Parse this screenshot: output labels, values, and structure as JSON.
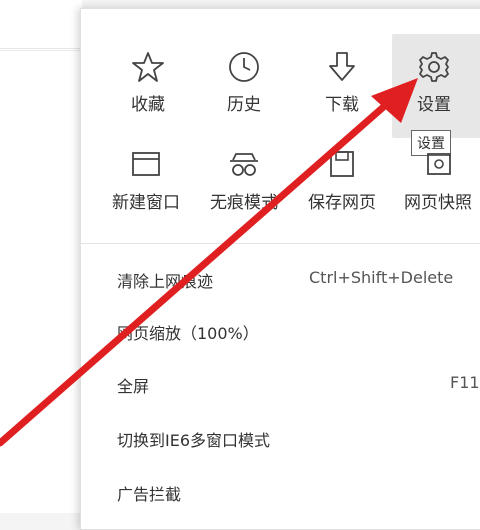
{
  "toolbar_icons": [
    {
      "label": "收藏",
      "icon": "star-icon"
    },
    {
      "label": "历史",
      "icon": "clock-icon"
    },
    {
      "label": "下载",
      "icon": "download-arrow-icon"
    },
    {
      "label": "设置",
      "icon": "gear-icon"
    }
  ],
  "second_row": [
    {
      "label": "新建窗口",
      "icon": "new-window-icon"
    },
    {
      "label": "无痕模式",
      "icon": "incognito-glasses-icon"
    },
    {
      "label": "保存网页",
      "icon": "save-page-icon"
    },
    {
      "label": "网页快照",
      "icon": "snapshot-icon"
    }
  ],
  "tooltip": "设置",
  "menu_items": [
    {
      "label": "清除上网痕迹",
      "shortcut": "Ctrl+Shift+Delete"
    },
    {
      "label": "网页缩放（100%）",
      "shortcut": ""
    },
    {
      "label": "全屏",
      "shortcut": "F11"
    },
    {
      "label": "切换到IE6多窗口模式",
      "shortcut": ""
    },
    {
      "label": "广告拦截",
      "shortcut": ""
    }
  ],
  "colors": {
    "annotation_arrow": "#e02020",
    "hover_bg": "#e7e7e7"
  }
}
